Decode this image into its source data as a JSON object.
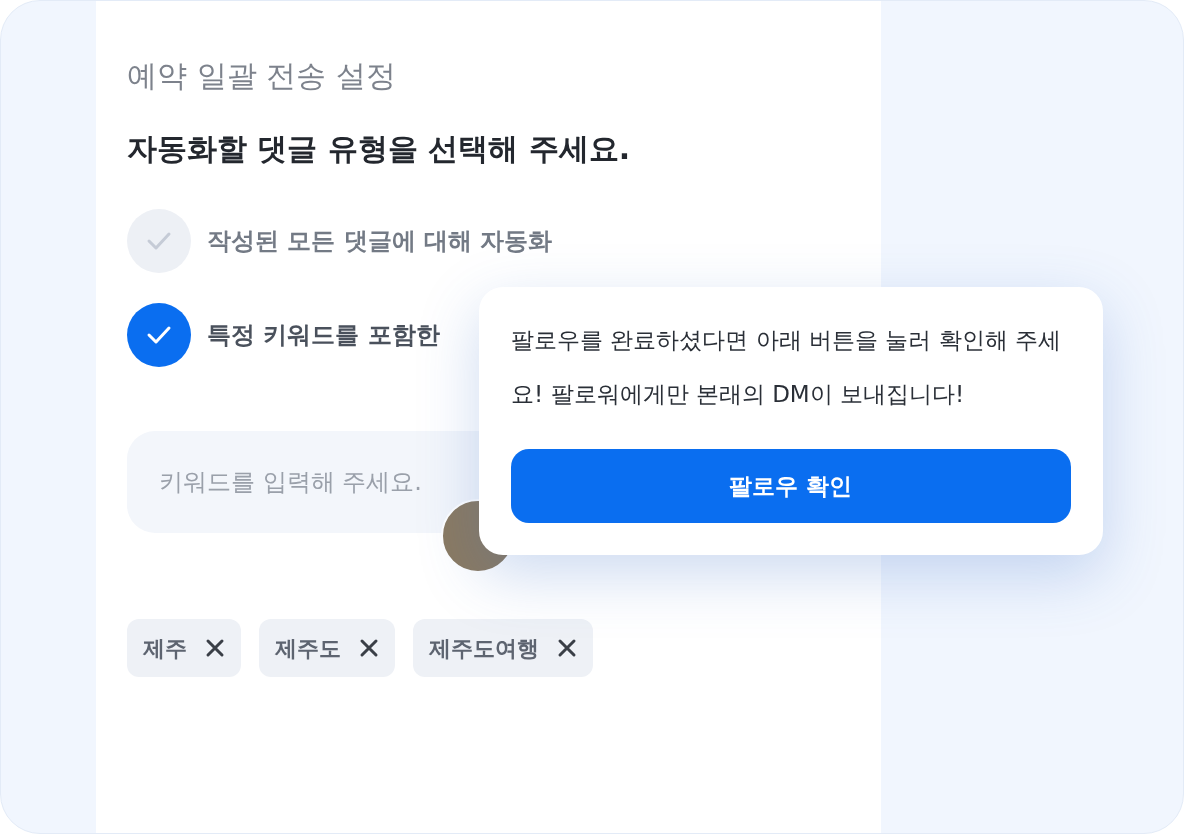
{
  "panel": {
    "title": "예약 일괄 전송 설정",
    "question": "자동화할 댓글 유형을 선택해 주세요.",
    "options": [
      {
        "label": "작성된 모든 댓글에 대해 자동화",
        "selected": false
      },
      {
        "label": "특정 키워드를 포함한",
        "selected": true
      }
    ],
    "keyword_field": {
      "placeholder": "키워드를 입력해 주세요."
    },
    "tags": [
      {
        "label": "제주"
      },
      {
        "label": "제주도"
      },
      {
        "label": "제주도여행"
      }
    ]
  },
  "popup": {
    "message": "팔로우를 완료하셨다면 아래 버튼을 눌러 확인해 주세요! 팔로워에게만 본래의 DM이 보내집니다!",
    "button": "팔로우 확인"
  }
}
